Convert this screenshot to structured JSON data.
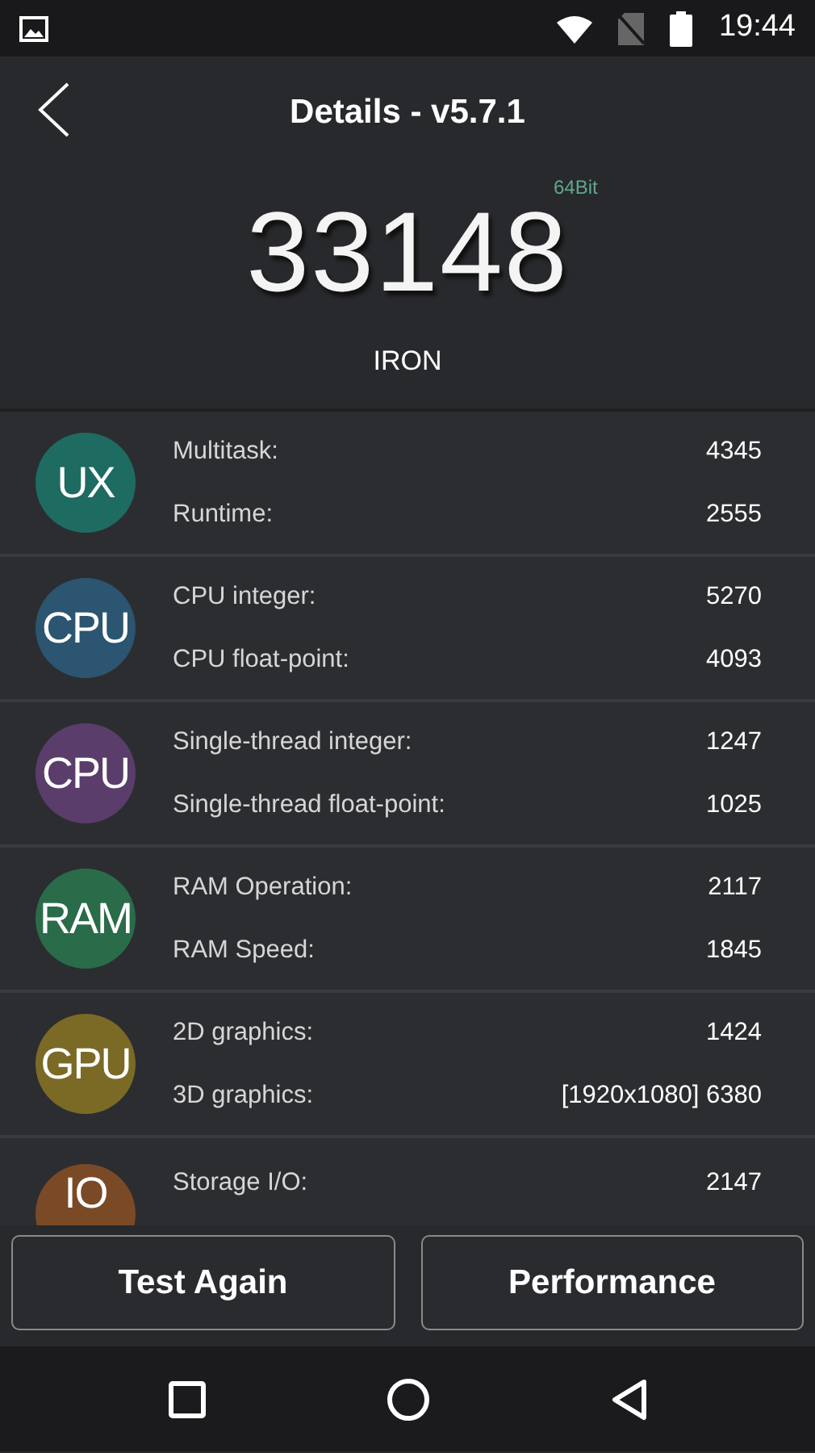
{
  "status_bar": {
    "time": "19:44"
  },
  "header": {
    "title": "Details - v5.7.1"
  },
  "score": {
    "value": "33148",
    "badge": "64Bit",
    "device": "IRON"
  },
  "categories": [
    {
      "label": "UX",
      "color": "#1e6b61",
      "metrics": [
        {
          "name": "Multitask:",
          "value": "4345"
        },
        {
          "name": "Runtime:",
          "value": "2555"
        }
      ]
    },
    {
      "label": "CPU",
      "color": "#2b5570",
      "metrics": [
        {
          "name": "CPU integer:",
          "value": "5270"
        },
        {
          "name": "CPU float-point:",
          "value": "4093"
        }
      ]
    },
    {
      "label": "CPU",
      "color": "#5a3d6b",
      "metrics": [
        {
          "name": "Single-thread integer:",
          "value": "1247"
        },
        {
          "name": "Single-thread float-point:",
          "value": "1025"
        }
      ]
    },
    {
      "label": "RAM",
      "color": "#2a6b4a",
      "metrics": [
        {
          "name": "RAM Operation:",
          "value": "2117"
        },
        {
          "name": "RAM Speed:",
          "value": "1845"
        }
      ]
    },
    {
      "label": "GPU",
      "color": "#7a6a26",
      "metrics": [
        {
          "name": "2D graphics:",
          "value": "1424"
        },
        {
          "name": "3D graphics:",
          "value": "[1920x1080] 6380"
        }
      ]
    },
    {
      "label": "IO",
      "color": "#7a4a26",
      "metrics": [
        {
          "name": "Storage I/O:",
          "value": "2147"
        }
      ]
    }
  ],
  "buttons": [
    "Test Again",
    "Performance"
  ]
}
